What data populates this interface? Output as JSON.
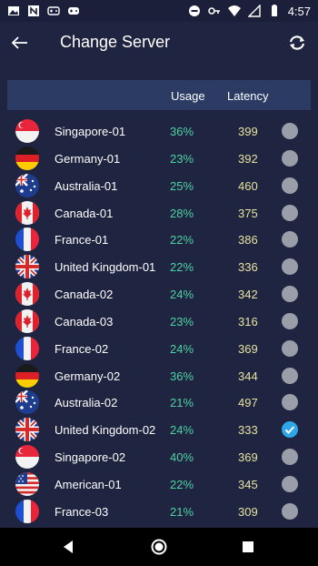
{
  "status_bar": {
    "time": "4:57",
    "left_icons": [
      "image-icon",
      "news-icon",
      "gamepad-icon",
      "gamepad-icon"
    ],
    "right_icons": [
      "dnd-icon",
      "key-icon",
      "wifi-icon",
      "signal-icon",
      "battery-icon"
    ]
  },
  "header": {
    "title": "Change Server",
    "back_icon": "arrow-left-icon",
    "refresh_icon": "refresh-icon"
  },
  "table": {
    "columns": {
      "usage": "Usage",
      "latency": "Latency"
    },
    "rows": [
      {
        "name": "Singapore-01",
        "usage": "36%",
        "latency": "399",
        "flag": "sg",
        "selected": false
      },
      {
        "name": "Germany-01",
        "usage": "23%",
        "latency": "392",
        "flag": "de",
        "selected": false
      },
      {
        "name": "Australia-01",
        "usage": "25%",
        "latency": "460",
        "flag": "au",
        "selected": false
      },
      {
        "name": "Canada-01",
        "usage": "28%",
        "latency": "375",
        "flag": "ca",
        "selected": false
      },
      {
        "name": "France-01",
        "usage": "22%",
        "latency": "386",
        "flag": "fr",
        "selected": false
      },
      {
        "name": "United Kingdom-01",
        "usage": "22%",
        "latency": "336",
        "flag": "gb",
        "selected": false
      },
      {
        "name": "Canada-02",
        "usage": "24%",
        "latency": "342",
        "flag": "ca",
        "selected": false
      },
      {
        "name": "Canada-03",
        "usage": "23%",
        "latency": "316",
        "flag": "ca",
        "selected": false
      },
      {
        "name": "France-02",
        "usage": "24%",
        "latency": "369",
        "flag": "fr",
        "selected": false
      },
      {
        "name": "Germany-02",
        "usage": "36%",
        "latency": "344",
        "flag": "de",
        "selected": false
      },
      {
        "name": "Australia-02",
        "usage": "21%",
        "latency": "497",
        "flag": "au",
        "selected": false
      },
      {
        "name": "United Kingdom-02",
        "usage": "24%",
        "latency": "333",
        "flag": "gb",
        "selected": true
      },
      {
        "name": "Singapore-02",
        "usage": "40%",
        "latency": "369",
        "flag": "sg",
        "selected": false
      },
      {
        "name": "American-01",
        "usage": "22%",
        "latency": "345",
        "flag": "us",
        "selected": false
      },
      {
        "name": "France-03",
        "usage": "21%",
        "latency": "309",
        "flag": "fr",
        "selected": false
      }
    ]
  },
  "nav_bar": {
    "icons": [
      "nav-back-icon",
      "nav-home-icon",
      "nav-recents-icon"
    ]
  },
  "colors": {
    "background": "#1f2440",
    "header_row": "#2b3b63",
    "usage": "#4fd1a5",
    "latency": "#e6e2a0",
    "radio_off": "#9a9ea8",
    "radio_on": "#2ea6e8"
  }
}
